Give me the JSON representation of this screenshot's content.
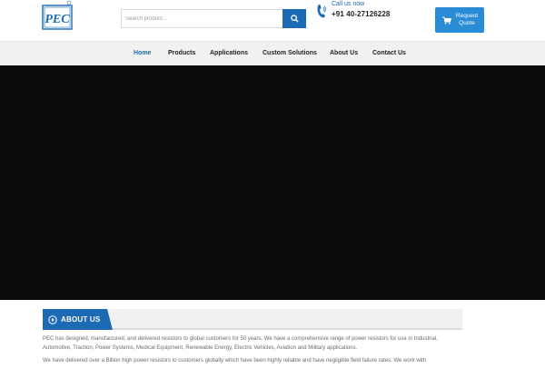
{
  "header": {
    "logo_text": "PEC",
    "search": {
      "placeholder": "Search product..."
    },
    "call_label": "Call us now",
    "phone": "+91 40-27126228",
    "quote_button": {
      "line1": "Request",
      "line2": "Quote"
    }
  },
  "nav": {
    "items": [
      {
        "label": "Home",
        "active": true
      },
      {
        "label": "Products"
      },
      {
        "label": "Applications"
      },
      {
        "label": "Custom Solutions"
      },
      {
        "label": "About Us"
      },
      {
        "label": "Contact Us"
      }
    ]
  },
  "about": {
    "title": "ABOUT US",
    "paragraph1": "PEC has designed, manufactured, and delivered resistors to global customers for 50 years. We have a comprehensive range of power resistors for use in Industrial, Automotive, Traction, Power Systems, Medical Equipment, Renewable Energy, Electric Vehicles, Aviation and Military applications.",
    "paragraph2": "We have delivered over a Billion high power resistors to customers globally which have been highly reliable and have negligible field failure rates. We work with"
  },
  "colors": {
    "brand_blue": "#1c69b4",
    "quote_blue": "#2a8bd6",
    "hero": "#0a0a0a"
  },
  "icons": {
    "search": "search-icon",
    "phone": "phone-icon",
    "cart": "cart-icon",
    "about": "play-circle-icon"
  }
}
